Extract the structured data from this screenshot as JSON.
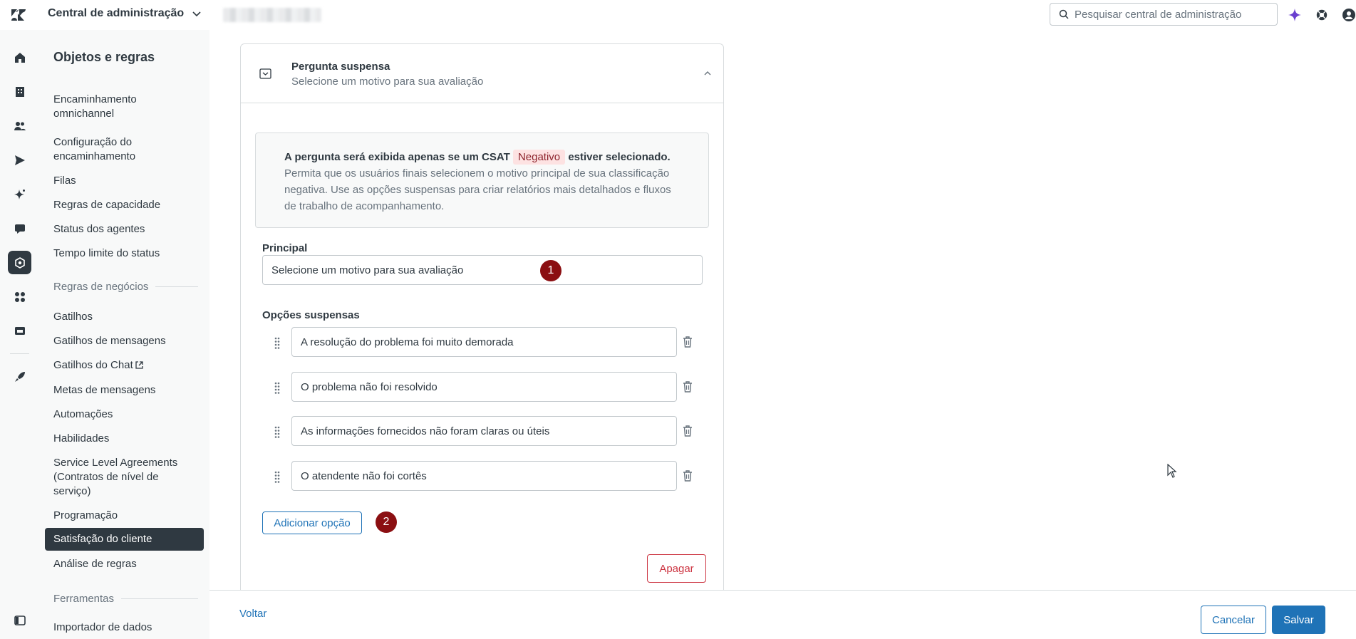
{
  "topbar": {
    "product_name": "Central de administração",
    "search_placeholder": "Pesquisar central de administração",
    "brand_color": "#2f3941",
    "icons": [
      "zendesk-logo-icon",
      "chevron-down-icon",
      "search-icon",
      "ai-sparkle-icon",
      "help-icon",
      "user-avatar-icon"
    ]
  },
  "rail": {
    "items": [
      "home-icon",
      "building-icon",
      "people-icon",
      "send-icon",
      "sparkle-icon",
      "chat-icon",
      "objects-rules-icon",
      "apps-icon",
      "workspace-icon",
      "rocket-icon",
      "sidebar-toggle-icon"
    ],
    "active": "objects-rules-icon"
  },
  "sidenav": {
    "title": "Objetos e regras",
    "items": [
      {
        "label": "Encaminhamento omnichannel"
      },
      {
        "label": "Configuração do encaminhamento"
      },
      {
        "label": "Filas"
      },
      {
        "label": "Regras de capacidade"
      },
      {
        "label": "Status dos agentes"
      },
      {
        "label": "Tempo limite do status"
      }
    ],
    "section_business": "Regras de negócios",
    "business_items": [
      {
        "label": "Gatilhos"
      },
      {
        "label": "Gatilhos de mensagens"
      },
      {
        "label": "Gatilhos do Chat"
      },
      {
        "label": "Metas de mensagens"
      },
      {
        "label": "Automações"
      },
      {
        "label": "Habilidades"
      },
      {
        "label": "Service Level Agreements (Contratos de nível de serviço)"
      },
      {
        "label": "Programação"
      },
      {
        "label": "Satisfação do cliente"
      },
      {
        "label": "Análise de regras"
      }
    ],
    "active_item": "Satisfação do cliente",
    "section_tools": "Ferramentas",
    "tools_items": [
      {
        "label": "Importador de dados"
      }
    ]
  },
  "card": {
    "title": "Pergunta suspensa",
    "subtitle": "Selecione um motivo para sua avaliação",
    "notice": {
      "strong_before": "A pergunta será exibida apenas se um CSAT",
      "tag": "Negativo",
      "strong_after": "estiver selecionado.",
      "body": "Permita que os usuários finais selecionem o motivo principal de sua classificação negativa. Use as opções suspensas para criar relatórios mais detalhados e fluxos de trabalho de acompanhamento."
    },
    "principal_label": "Principal",
    "principal_value": "Selecione um motivo para sua avaliação",
    "options_label": "Opções suspensas",
    "options": [
      "A resolução do problema foi muito demorada",
      "O problema não foi resolvido",
      "As informações fornecidos não foram claras ou úteis",
      "O atendente não foi cortês"
    ],
    "add_option": "Adicionar opção",
    "delete": "Apagar",
    "markers": [
      "1",
      "2"
    ]
  },
  "footer": {
    "back": "Voltar",
    "cancel": "Cancelar",
    "save": "Salvar"
  },
  "colors": {
    "accent": "#1f73b7",
    "danger": "#cc3340",
    "marker": "#8b0f12",
    "tag_bg": "#fde2e2"
  }
}
